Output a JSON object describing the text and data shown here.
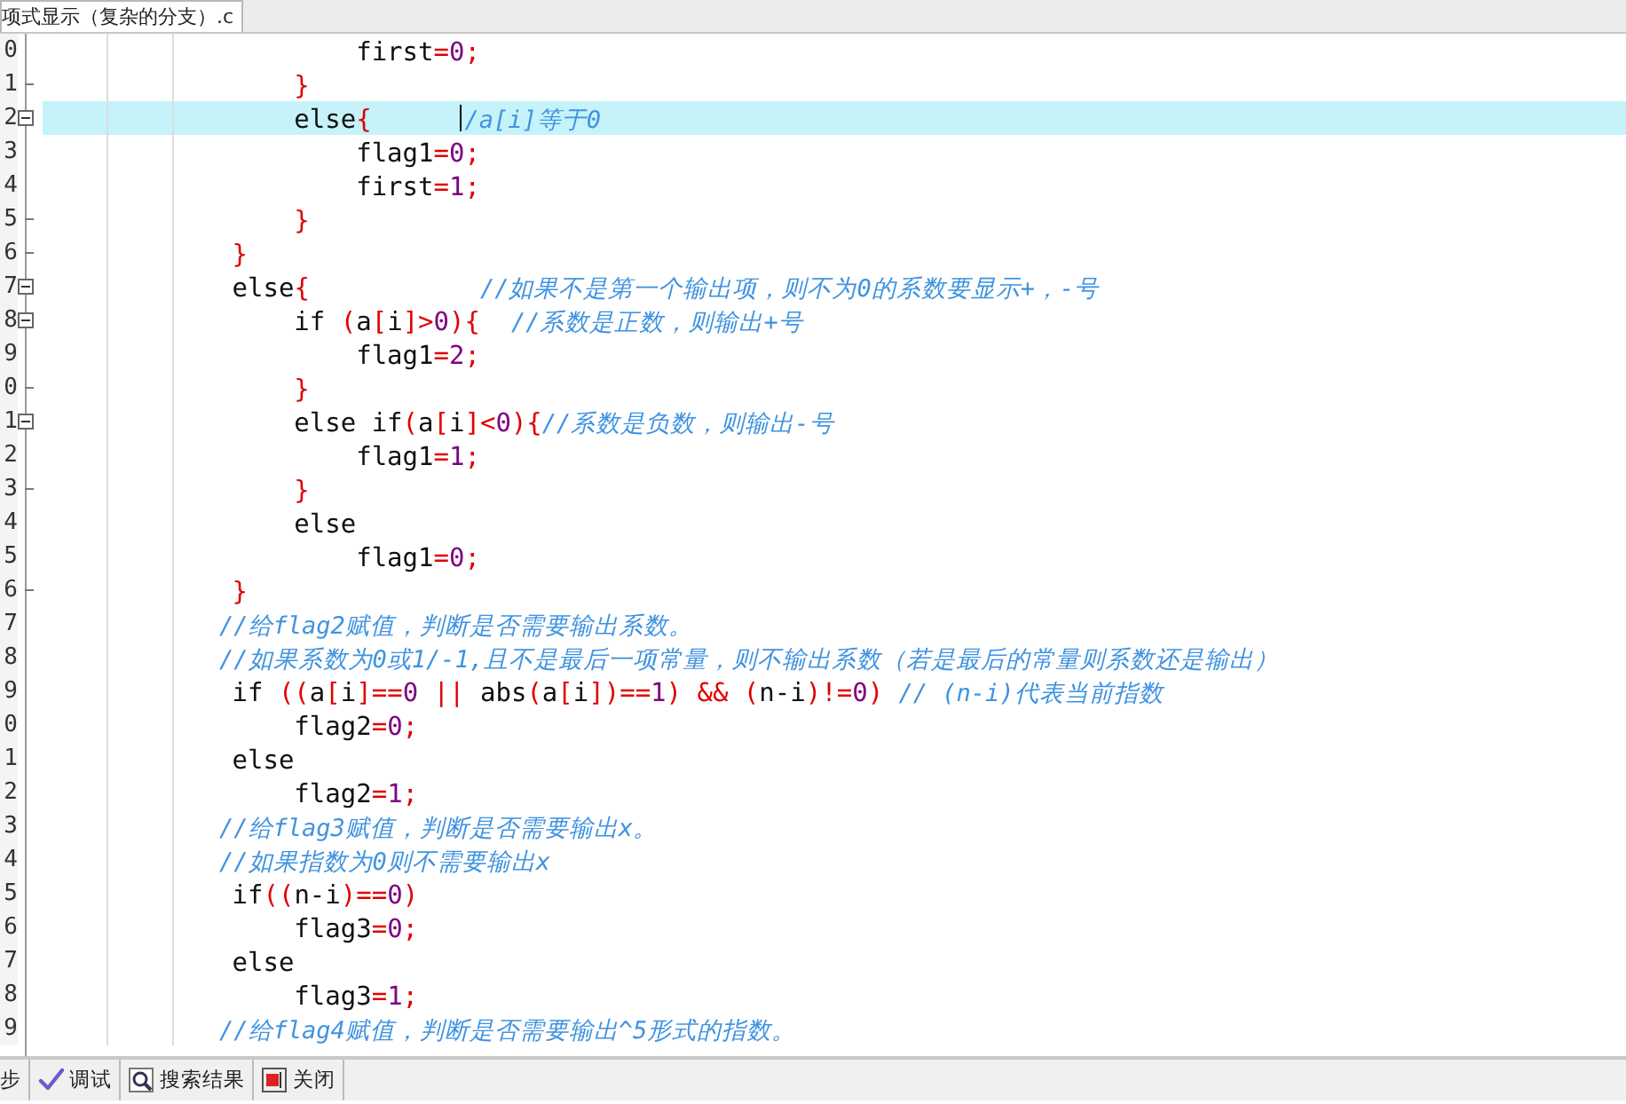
{
  "file_tab": {
    "title": "项式显示（复杂的分支）.c"
  },
  "lines": [
    {
      "number": "0",
      "collapsible": false,
      "block_end": false,
      "highlighted": false,
      "cursor": false,
      "code": [
        {
          "kind": "text",
          "text": "                    first"
        },
        {
          "kind": "op",
          "text": "="
        },
        {
          "kind": "num",
          "text": "0"
        },
        {
          "kind": "op",
          "text": ";"
        }
      ]
    },
    {
      "number": "1",
      "collapsible": false,
      "block_end": true,
      "highlighted": false,
      "cursor": false,
      "code": [
        {
          "kind": "op",
          "text": "                }"
        }
      ]
    },
    {
      "number": "2",
      "collapsible": true,
      "block_end": false,
      "highlighted": true,
      "cursor": true,
      "code": [
        {
          "kind": "text",
          "text": "                else"
        },
        {
          "kind": "op",
          "text": "{      "
        },
        {
          "kind": "comment",
          "text": "/a[i]等于0"
        }
      ]
    },
    {
      "number": "3",
      "collapsible": false,
      "block_end": false,
      "highlighted": false,
      "cursor": false,
      "code": [
        {
          "kind": "text",
          "text": "                    flag1"
        },
        {
          "kind": "op",
          "text": "="
        },
        {
          "kind": "num",
          "text": "0"
        },
        {
          "kind": "op",
          "text": ";"
        }
      ]
    },
    {
      "number": "4",
      "collapsible": false,
      "block_end": false,
      "highlighted": false,
      "cursor": false,
      "code": [
        {
          "kind": "text",
          "text": "                    first"
        },
        {
          "kind": "op",
          "text": "="
        },
        {
          "kind": "num",
          "text": "1"
        },
        {
          "kind": "op",
          "text": ";"
        }
      ]
    },
    {
      "number": "5",
      "collapsible": false,
      "block_end": true,
      "highlighted": false,
      "cursor": false,
      "code": [
        {
          "kind": "op",
          "text": "                }"
        }
      ]
    },
    {
      "number": "6",
      "collapsible": false,
      "block_end": true,
      "highlighted": false,
      "cursor": false,
      "code": [
        {
          "kind": "op",
          "text": "            }"
        }
      ]
    },
    {
      "number": "7",
      "collapsible": true,
      "block_end": false,
      "highlighted": false,
      "cursor": false,
      "code": [
        {
          "kind": "text",
          "text": "            else"
        },
        {
          "kind": "op",
          "text": "{           "
        },
        {
          "kind": "comment",
          "text": "//如果不是第一个输出项，则不为0的系数要显示+，-号"
        }
      ]
    },
    {
      "number": "8",
      "collapsible": true,
      "block_end": false,
      "highlighted": false,
      "cursor": false,
      "code": [
        {
          "kind": "text",
          "text": "                if "
        },
        {
          "kind": "op",
          "text": "("
        },
        {
          "kind": "text",
          "text": "a"
        },
        {
          "kind": "op",
          "text": "["
        },
        {
          "kind": "text",
          "text": "i"
        },
        {
          "kind": "op",
          "text": "]>"
        },
        {
          "kind": "num",
          "text": "0"
        },
        {
          "kind": "op",
          "text": "){  "
        },
        {
          "kind": "comment",
          "text": "//系数是正数，则输出+号"
        }
      ]
    },
    {
      "number": "9",
      "collapsible": false,
      "block_end": false,
      "highlighted": false,
      "cursor": false,
      "code": [
        {
          "kind": "text",
          "text": "                    flag1"
        },
        {
          "kind": "op",
          "text": "="
        },
        {
          "kind": "num",
          "text": "2"
        },
        {
          "kind": "op",
          "text": ";"
        }
      ]
    },
    {
      "number": "0",
      "collapsible": false,
      "block_end": true,
      "highlighted": false,
      "cursor": false,
      "code": [
        {
          "kind": "op",
          "text": "                }"
        }
      ]
    },
    {
      "number": "1",
      "collapsible": true,
      "block_end": false,
      "highlighted": false,
      "cursor": false,
      "code": [
        {
          "kind": "text",
          "text": "                else if"
        },
        {
          "kind": "op",
          "text": "("
        },
        {
          "kind": "text",
          "text": "a"
        },
        {
          "kind": "op",
          "text": "["
        },
        {
          "kind": "text",
          "text": "i"
        },
        {
          "kind": "op",
          "text": "]<"
        },
        {
          "kind": "num",
          "text": "0"
        },
        {
          "kind": "op",
          "text": "){"
        },
        {
          "kind": "comment",
          "text": "//系数是负数，则输出-号"
        }
      ]
    },
    {
      "number": "2",
      "collapsible": false,
      "block_end": false,
      "highlighted": false,
      "cursor": false,
      "code": [
        {
          "kind": "text",
          "text": "                    flag1"
        },
        {
          "kind": "op",
          "text": "="
        },
        {
          "kind": "num",
          "text": "1"
        },
        {
          "kind": "op",
          "text": ";"
        }
      ]
    },
    {
      "number": "3",
      "collapsible": false,
      "block_end": true,
      "highlighted": false,
      "cursor": false,
      "code": [
        {
          "kind": "op",
          "text": "                }"
        }
      ]
    },
    {
      "number": "4",
      "collapsible": false,
      "block_end": false,
      "highlighted": false,
      "cursor": false,
      "code": [
        {
          "kind": "text",
          "text": "                else"
        }
      ]
    },
    {
      "number": "5",
      "collapsible": false,
      "block_end": false,
      "highlighted": false,
      "cursor": false,
      "code": [
        {
          "kind": "text",
          "text": "                    flag1"
        },
        {
          "kind": "op",
          "text": "="
        },
        {
          "kind": "num",
          "text": "0"
        },
        {
          "kind": "op",
          "text": ";"
        }
      ]
    },
    {
      "number": "6",
      "collapsible": false,
      "block_end": true,
      "highlighted": false,
      "cursor": false,
      "code": [
        {
          "kind": "op",
          "text": "            }"
        }
      ]
    },
    {
      "number": "7",
      "collapsible": false,
      "block_end": false,
      "highlighted": false,
      "cursor": false,
      "code": [
        {
          "kind": "comment",
          "text": "            //给flag2赋值，判断是否需要输出系数。"
        }
      ]
    },
    {
      "number": "8",
      "collapsible": false,
      "block_end": false,
      "highlighted": false,
      "cursor": false,
      "code": [
        {
          "kind": "comment",
          "text": "            //如果系数为0或1/-1,且不是最后一项常量，则不输出系数（若是最后的常量则系数还是输出）"
        }
      ]
    },
    {
      "number": "9",
      "collapsible": false,
      "block_end": false,
      "highlighted": false,
      "cursor": false,
      "code": [
        {
          "kind": "text",
          "text": "            if "
        },
        {
          "kind": "op",
          "text": "(("
        },
        {
          "kind": "text",
          "text": "a"
        },
        {
          "kind": "op",
          "text": "["
        },
        {
          "kind": "text",
          "text": "i"
        },
        {
          "kind": "op",
          "text": "]=="
        },
        {
          "kind": "num",
          "text": "0"
        },
        {
          "kind": "op",
          "text": " || "
        },
        {
          "kind": "text",
          "text": "abs"
        },
        {
          "kind": "op",
          "text": "("
        },
        {
          "kind": "text",
          "text": "a"
        },
        {
          "kind": "op",
          "text": "["
        },
        {
          "kind": "text",
          "text": "i"
        },
        {
          "kind": "op",
          "text": "])=="
        },
        {
          "kind": "num",
          "text": "1"
        },
        {
          "kind": "op",
          "text": ") && ("
        },
        {
          "kind": "text",
          "text": "n-i"
        },
        {
          "kind": "op",
          "text": ")!="
        },
        {
          "kind": "num",
          "text": "0"
        },
        {
          "kind": "op",
          "text": ") "
        },
        {
          "kind": "comment",
          "text": "// (n-i)代表当前指数"
        }
      ]
    },
    {
      "number": "0",
      "collapsible": false,
      "block_end": false,
      "highlighted": false,
      "cursor": false,
      "code": [
        {
          "kind": "text",
          "text": "                flag2"
        },
        {
          "kind": "op",
          "text": "="
        },
        {
          "kind": "num",
          "text": "0"
        },
        {
          "kind": "op",
          "text": ";"
        }
      ]
    },
    {
      "number": "1",
      "collapsible": false,
      "block_end": false,
      "highlighted": false,
      "cursor": false,
      "code": [
        {
          "kind": "text",
          "text": "            else"
        }
      ]
    },
    {
      "number": "2",
      "collapsible": false,
      "block_end": false,
      "highlighted": false,
      "cursor": false,
      "code": [
        {
          "kind": "text",
          "text": "                flag2"
        },
        {
          "kind": "op",
          "text": "="
        },
        {
          "kind": "num",
          "text": "1"
        },
        {
          "kind": "op",
          "text": ";"
        }
      ]
    },
    {
      "number": "3",
      "collapsible": false,
      "block_end": false,
      "highlighted": false,
      "cursor": false,
      "code": [
        {
          "kind": "comment",
          "text": "            //给flag3赋值，判断是否需要输出x。"
        }
      ]
    },
    {
      "number": "4",
      "collapsible": false,
      "block_end": false,
      "highlighted": false,
      "cursor": false,
      "code": [
        {
          "kind": "comment",
          "text": "            //如果指数为0则不需要输出x"
        }
      ]
    },
    {
      "number": "5",
      "collapsible": false,
      "block_end": false,
      "highlighted": false,
      "cursor": false,
      "code": [
        {
          "kind": "text",
          "text": "            if"
        },
        {
          "kind": "op",
          "text": "(("
        },
        {
          "kind": "text",
          "text": "n-i"
        },
        {
          "kind": "op",
          "text": ")=="
        },
        {
          "kind": "num",
          "text": "0"
        },
        {
          "kind": "op",
          "text": ")"
        }
      ]
    },
    {
      "number": "6",
      "collapsible": false,
      "block_end": false,
      "highlighted": false,
      "cursor": false,
      "code": [
        {
          "kind": "text",
          "text": "                flag3"
        },
        {
          "kind": "op",
          "text": "="
        },
        {
          "kind": "num",
          "text": "0"
        },
        {
          "kind": "op",
          "text": ";"
        }
      ]
    },
    {
      "number": "7",
      "collapsible": false,
      "block_end": false,
      "highlighted": false,
      "cursor": false,
      "code": [
        {
          "kind": "text",
          "text": "            else"
        }
      ]
    },
    {
      "number": "8",
      "collapsible": false,
      "block_end": false,
      "highlighted": false,
      "cursor": false,
      "code": [
        {
          "kind": "text",
          "text": "                flag3"
        },
        {
          "kind": "op",
          "text": "="
        },
        {
          "kind": "num",
          "text": "1"
        },
        {
          "kind": "op",
          "text": ";"
        }
      ]
    },
    {
      "number": "9",
      "collapsible": false,
      "block_end": false,
      "highlighted": false,
      "cursor": false,
      "code": [
        {
          "kind": "comment",
          "text": "            //给flag4赋值，判断是否需要输出^5形式的指数。"
        }
      ]
    }
  ],
  "bottom_tabs": [
    {
      "label": "步",
      "kind": "plain"
    },
    {
      "label": "调试",
      "kind": "check"
    },
    {
      "label": "搜索结果",
      "kind": "search"
    },
    {
      "label": "关闭",
      "kind": "close"
    }
  ]
}
